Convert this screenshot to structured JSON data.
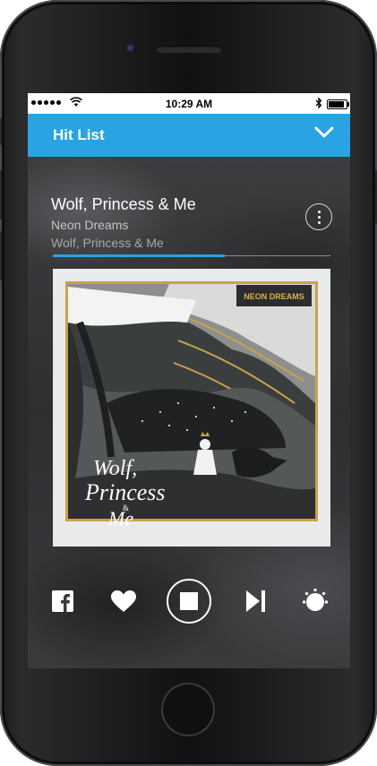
{
  "status_bar": {
    "time": "10:29 AM",
    "battery_level": 0.88
  },
  "header": {
    "title": "Hit List",
    "chevron_icon": "chevron-down-icon"
  },
  "now_playing": {
    "song_title": "Wolf, Princess & Me",
    "artist": "Neon Dreams",
    "album": "Wolf, Princess & Me",
    "progress": 0.62
  },
  "album_art": {
    "logo_text": "NEON DREAMS",
    "cover_title_line1": "Wolf,",
    "cover_title_line2": "Princess",
    "cover_title_amp": "&",
    "cover_title_line3": "Me"
  },
  "controls": {
    "facebook": "facebook-icon",
    "heart": "heart-icon",
    "stop": "stop-icon",
    "skip": "skip-next-icon",
    "brightness": "brightness-icon"
  },
  "colors": {
    "accent": "#29a3e3",
    "background": "#3a3a3c"
  }
}
